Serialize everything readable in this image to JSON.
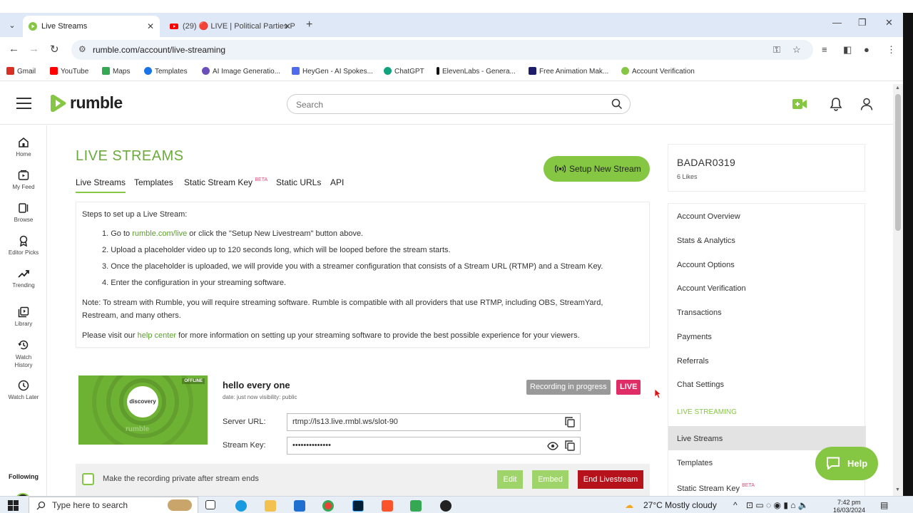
{
  "browser": {
    "tabs": [
      {
        "title": "Live Streams",
        "active": true
      },
      {
        "title": "(29) 🔴 LIVE | Political Parties P",
        "active": false
      }
    ],
    "url": "rumble.com/account/live-streaming",
    "bookmarks": [
      {
        "label": "Gmail",
        "color": "#d93025"
      },
      {
        "label": "YouTube",
        "color": "#ff0000"
      },
      {
        "label": "Maps",
        "color": "#34a853"
      },
      {
        "label": "Templates",
        "color": "#1a73e8"
      },
      {
        "label": "AI Image Generatio...",
        "color": "#6b4fbb"
      },
      {
        "label": "HeyGen - AI Spokes...",
        "color": "#4f6bed"
      },
      {
        "label": "ChatGPT",
        "color": "#10a37f"
      },
      {
        "label": "ElevenLabs - Genera...",
        "color": "#111111"
      },
      {
        "label": "Free Animation Mak...",
        "color": "#1d1d6b"
      },
      {
        "label": "Account Verification",
        "color": "#85c742"
      }
    ]
  },
  "header": {
    "logo_text": "rumble",
    "search_placeholder": "Search"
  },
  "leftnav": [
    {
      "label": "Home",
      "icon": "home-icon"
    },
    {
      "label": "My Feed",
      "icon": "feed-icon"
    },
    {
      "label": "Browse",
      "icon": "browse-icon"
    },
    {
      "label": "Editor Picks",
      "icon": "ribbon-icon"
    },
    {
      "label": "Trending",
      "icon": "trending-icon"
    },
    {
      "label": "Library",
      "icon": "library-icon"
    },
    {
      "label": "Watch History",
      "icon": "history-icon"
    },
    {
      "label": "Watch Later",
      "icon": "clock-icon"
    }
  ],
  "following_label": "Following",
  "main": {
    "title": "LIVE STREAMS",
    "tabs": [
      "Live Streams",
      "Templates",
      "Static Stream Key",
      "Static URLs",
      "API"
    ],
    "beta": "BETA",
    "setup_button": "Setup New Stream",
    "steps_intro": "Steps to set up a Live Stream:",
    "step1_pre": "1. Go to ",
    "step1_link": "rumble.com/live",
    "step1_post": " or click the \"Setup New Livestream\" button above.",
    "step2": "2. Upload a placeholder video up to 120 seconds long, which will be looped before the stream starts.",
    "step3": "3. Once the placeholder is uploaded, we will provide you with a streamer configuration that consists of a Stream URL (RTMP) and a Stream Key.",
    "step4": "4. Enter the configuration in your streaming software.",
    "note": "Note: To stream with Rumble, you will require streaming software. Rumble is compatible with all providers that use RTMP, including OBS, StreamYard,",
    "note2": "Restream, and many others.",
    "visit_pre": "Please visit our ",
    "visit_link": "help center",
    "visit_post": " for more information on setting up your streaming software to provide the best possible experience for your viewers."
  },
  "stream": {
    "title": "hello every one",
    "meta": "date: just now  visibility: public",
    "offline_badge": "OFFLINE",
    "thumb_text": "discovery",
    "thumb_logo": "rumble",
    "recording": "Recording in progress",
    "live": "LIVE",
    "server_label": "Server URL:",
    "server_value": "rtmp://ls13.live.rmbl.ws/slot-90",
    "key_label": "Stream Key:",
    "key_value": "••••••••••••••",
    "private_label": "Make the recording private after stream ends",
    "edit": "Edit",
    "embed": "Embed",
    "end": "End Livestream"
  },
  "account": {
    "username": "BADAR0319",
    "likes": "6 Likes",
    "menu": [
      "Account Overview",
      "Stats & Analytics",
      "Account Options",
      "Account Verification",
      "Transactions",
      "Payments",
      "Referrals",
      "Chat Settings"
    ],
    "section": "LIVE STREAMING",
    "live_menu": [
      "Live Streams",
      "Templates",
      "Static Stream Key"
    ]
  },
  "help_label": "Help",
  "taskbar": {
    "search_placeholder": "Type here to search",
    "weather": "27°C  Mostly cloudy",
    "time": "7:42 pm",
    "date": "16/03/2024"
  },
  "colors": {
    "brand_green": "#85c742",
    "live_pink": "#e02d68",
    "end_red": "#b5121b"
  }
}
